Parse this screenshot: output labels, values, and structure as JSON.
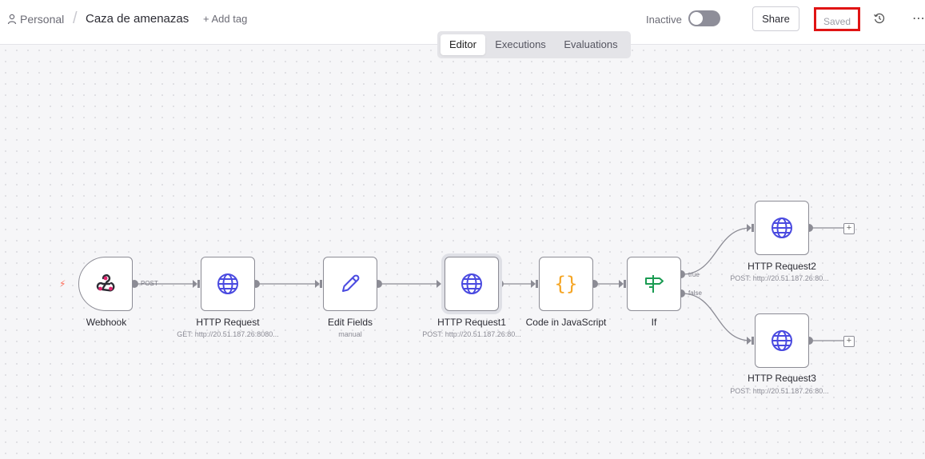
{
  "breadcrumb": {
    "project": "Personal",
    "separator": "/",
    "workflow_name": "Caza de amenazas",
    "add_tag": "+ Add tag"
  },
  "header": {
    "status_label": "Inactive",
    "share_label": "Share",
    "saved_label": "Saved",
    "active": false
  },
  "tabs": [
    {
      "label": "Editor",
      "active": true
    },
    {
      "label": "Executions",
      "active": false
    },
    {
      "label": "Evaluations",
      "active": false
    }
  ],
  "nodes": {
    "webhook": {
      "name": "Webhook",
      "subtitle": ""
    },
    "http1": {
      "name": "HTTP Request",
      "subtitle": "GET: http://20.51.187.26:8080..."
    },
    "edit": {
      "name": "Edit Fields",
      "subtitle": "manual"
    },
    "http2": {
      "name": "HTTP Request1",
      "subtitle": "POST: http://20.51.187.26:80..."
    },
    "code": {
      "name": "Code in JavaScript",
      "subtitle": ""
    },
    "if": {
      "name": "If",
      "subtitle": ""
    },
    "http3": {
      "name": "HTTP Request2",
      "subtitle": "POST: http://20.51.187.26:80..."
    },
    "http4": {
      "name": "HTTP Request3",
      "subtitle": "POST: http://20.51.187.26:80..."
    }
  },
  "edge_labels": {
    "webhook_method": "POST",
    "if_true": "true",
    "if_false": "false"
  },
  "colors": {
    "globe": "#4a4ae0",
    "pencil": "#4a4ae0",
    "code": "#f5a524",
    "if": "#1a9b52",
    "trigger": "#ff6d5a",
    "saved_border": "#e01414"
  }
}
